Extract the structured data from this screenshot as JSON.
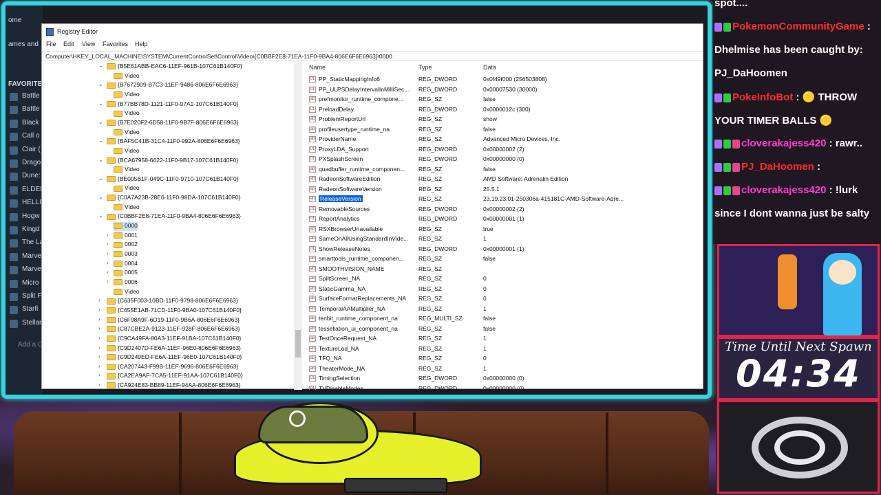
{
  "steam": {
    "top_text": "ome",
    "games_text": "ames and",
    "favorites": "FAVORITE",
    "items": [
      "Battle",
      "Battle",
      "Black",
      "Call o",
      "Clair (",
      "Drago",
      "Dune:",
      "ELDEN",
      "HELLI",
      "Hogw",
      "Kingd",
      "The La",
      "Marve",
      "Marve",
      "Micro",
      "Split F",
      "Starfi",
      "Stellar"
    ],
    "add": "Add a G"
  },
  "reg": {
    "title": "Registry Editor",
    "menu": [
      "File",
      "Edit",
      "View",
      "Favorites",
      "Help"
    ],
    "address": "Computer\\HKEY_LOCAL_MACHINE\\SYSTEM\\CurrentControlSet\\Control\\Video\\{C0BBF2E8-71EA-11F0-9BA4-806E6F6E6963}\\0000",
    "tree": [
      {
        "label": "{B5E61ABB-EAC6-11EF-961B-107C61B140F0}",
        "indent": 0,
        "chev": "⌄"
      },
      {
        "label": "Video",
        "indent": 1,
        "chev": ""
      },
      {
        "label": "{B7672909-B7C3-11EF-9486-806E6F6E6963}",
        "indent": 0,
        "chev": "⌄"
      },
      {
        "label": "Video",
        "indent": 1,
        "chev": ""
      },
      {
        "label": "{B77BB78D-1121-11F0-97A1-107C61B140F0}",
        "indent": 0,
        "chev": "⌄"
      },
      {
        "label": "Video",
        "indent": 1,
        "chev": ""
      },
      {
        "label": "{B7E020F2-6D58-11F0-9B7F-806E6F6E6963}",
        "indent": 0,
        "chev": "⌄"
      },
      {
        "label": "Video",
        "indent": 1,
        "chev": ""
      },
      {
        "label": "{BAF5C41B-31C4-11F0-992A-806E6F6E6963}",
        "indent": 0,
        "chev": "⌄"
      },
      {
        "label": "Video",
        "indent": 1,
        "chev": ""
      },
      {
        "label": "{BCA67958-6622-11F0-9B17-107C61B140F0}",
        "indent": 0,
        "chev": "⌄"
      },
      {
        "label": "Video",
        "indent": 1,
        "chev": ""
      },
      {
        "label": "{BE005B1F-049C-11F0-9710-107C61B140F0}",
        "indent": 0,
        "chev": "⌄"
      },
      {
        "label": "Video",
        "indent": 1,
        "chev": ""
      },
      {
        "label": "{C0A7A23B-28E6-11F0-98DA-107C61B140F0}",
        "indent": 0,
        "chev": "⌄"
      },
      {
        "label": "Video",
        "indent": 1,
        "chev": ""
      },
      {
        "label": "{C0BBF2E8-71EA-11F0-9BA4-806E6F6E6963}",
        "indent": 0,
        "chev": "⌄"
      },
      {
        "label": "0000",
        "indent": 1,
        "chev": "",
        "selected": true
      },
      {
        "label": "0001",
        "indent": 1,
        "chev": "›"
      },
      {
        "label": "0002",
        "indent": 1,
        "chev": "›"
      },
      {
        "label": "0003",
        "indent": 1,
        "chev": "›"
      },
      {
        "label": "0004",
        "indent": 1,
        "chev": "›"
      },
      {
        "label": "0005",
        "indent": 1,
        "chev": "›"
      },
      {
        "label": "0006",
        "indent": 1,
        "chev": "›"
      },
      {
        "label": "Video",
        "indent": 1,
        "chev": ""
      },
      {
        "label": "{C635F003-10BD-11F0-9798-806E6F6E6963}",
        "indent": 0,
        "chev": "›"
      },
      {
        "label": "{C655E1AB-71CD-11F0-9BA0-107C61B140F0}",
        "indent": 0,
        "chev": "›"
      },
      {
        "label": "{C6F98A9F-6D19-11F0-9B6A-806E6F6E6963}",
        "indent": 0,
        "chev": "›"
      },
      {
        "label": "{C87CBE2A-9123-11EF-928F-806E6F6E6963}",
        "indent": 0,
        "chev": "›"
      },
      {
        "label": "{C9CA49FA-80A3-11EF-91BA-107C61B140F0}",
        "indent": 0,
        "chev": "›"
      },
      {
        "label": "{C9D2407D-FE6A-11EF-96E0-806E6F6E6963}",
        "indent": 0,
        "chev": "›"
      },
      {
        "label": "{C9D249ED-FE6A-11EF-96E0-107C61B140F0}",
        "indent": 0,
        "chev": "›"
      },
      {
        "label": "{CA207443-F99B-11EF-9696-806E6F6E6963}",
        "indent": 0,
        "chev": "›"
      },
      {
        "label": "{CA2EA9AF-7CA5-11EF-91AA-107C61B140F0}",
        "indent": 0,
        "chev": "›"
      },
      {
        "label": "{CA924E83-BB89-11EF-94AA-806E6F6E6963}",
        "indent": 0,
        "chev": "›"
      }
    ],
    "columns": [
      "Name",
      "Type",
      "Data"
    ],
    "rows": [
      [
        "PP_StaticMappingInfo6",
        "REG_DWORD",
        "0x0f49f000 (256503808)"
      ],
      [
        "PP_ULPSDelayIntervalInMilliSec...",
        "REG_DWORD",
        "0x00007530 (30000)"
      ],
      [
        "prefmonitor_runtime_compone...",
        "REG_SZ",
        "false"
      ],
      [
        "PreloadDelay",
        "REG_DWORD",
        "0x0000012c (300)"
      ],
      [
        "ProblemReportUrl",
        "REG_SZ",
        "show"
      ],
      [
        "profileusertype_runtime_na",
        "REG_SZ",
        "false"
      ],
      [
        "ProviderName",
        "REG_SZ",
        "Advanced Micro Devices, Inc."
      ],
      [
        "ProxyLDA_Support",
        "REG_DWORD",
        "0x00000002 (2)"
      ],
      [
        "PXSplashScreen",
        "REG_DWORD",
        "0x00000000 (0)"
      ],
      [
        "quadbuffer_runtime_componen...",
        "REG_SZ",
        "false"
      ],
      [
        "RadeonSoftwareEdition",
        "REG_SZ",
        "AMD Software: Adrenalin Edition"
      ],
      [
        "RadeonSoftwareVersion",
        "REG_SZ",
        "25.5.1"
      ],
      [
        "ReleaseVersion",
        "REG_SZ",
        "23.19.23.01-250306a-415181C-AMD-Software-Adre..."
      ],
      [
        "RemovableSources",
        "REG_DWORD",
        "0x00000002 (2)"
      ],
      [
        "ReportAnalytics",
        "REG_DWORD",
        "0x00000001 (1)"
      ],
      [
        "RSXBrowserUnavailable",
        "REG_SZ",
        "true"
      ],
      [
        "SameOnAllUsingStandardInVide...",
        "REG_SZ",
        "1"
      ],
      [
        "ShowReleaseNotes",
        "REG_DWORD",
        "0x00000001 (1)"
      ],
      [
        "smarttools_runtime_componen...",
        "REG_SZ",
        "false"
      ],
      [
        "SMOOTHVISION_NAME",
        "REG_SZ",
        ""
      ],
      [
        "SplitScreen_NA",
        "REG_SZ",
        "0"
      ],
      [
        "StaticGamma_NA",
        "REG_SZ",
        "0"
      ],
      [
        "SurfaceFormatReplacements_NA",
        "REG_SZ",
        "0"
      ],
      [
        "TemporalAAMultiplier_NA",
        "REG_SZ",
        "1"
      ],
      [
        "tenbit_runtime_component_na",
        "REG_MULTI_SZ",
        "false"
      ],
      [
        "tessellation_ui_component_na",
        "REG_SZ",
        "false"
      ],
      [
        "TestOnceRequest_NA",
        "REG_SZ",
        "1"
      ],
      [
        "TextureLod_NA",
        "REG_SZ",
        "1"
      ],
      [
        "TFQ_NA",
        "REG_SZ",
        "0"
      ],
      [
        "TheaterMode_NA",
        "REG_SZ",
        "1"
      ],
      [
        "TimingSelection",
        "REG_DWORD",
        "0x00000000 (0)"
      ],
      [
        "TVDisableModes",
        "REG_DWORD",
        "0x00000000 (0)"
      ]
    ],
    "selected_row": 12
  },
  "chat": {
    "lines": [
      {
        "user": "",
        "text": "spot....",
        "badges": 0
      },
      {
        "user": "PokemonCommunityGame",
        "text": " :",
        "badges": 2,
        "color": "red"
      },
      {
        "user": "",
        "text": "Dhelmise has been caught by:",
        "badges": 0
      },
      {
        "user": "",
        "text": "PJ_DaHoomen",
        "badges": 0
      },
      {
        "user": "PokeInfoBot",
        "text": " : 🟡 THROW",
        "badges": 2,
        "color": "red"
      },
      {
        "user": "",
        "text": "YOUR TIMER BALLS 🟡",
        "badges": 0
      },
      {
        "user": "cloverakajess420",
        "text": " : rawr..",
        "badges": 3,
        "color": "mag"
      },
      {
        "user": "PJ_DaHoomen",
        "text": " :",
        "badges": 3,
        "color": "red"
      },
      {
        "user": "cloverakajess420",
        "text": " : !lurk",
        "badges": 3,
        "color": "mag"
      },
      {
        "user": "",
        "text": "since I dont wanna just be salty",
        "badges": 0
      }
    ]
  },
  "timer": {
    "label": "Time Until Next Spawn",
    "value": "04:34"
  }
}
